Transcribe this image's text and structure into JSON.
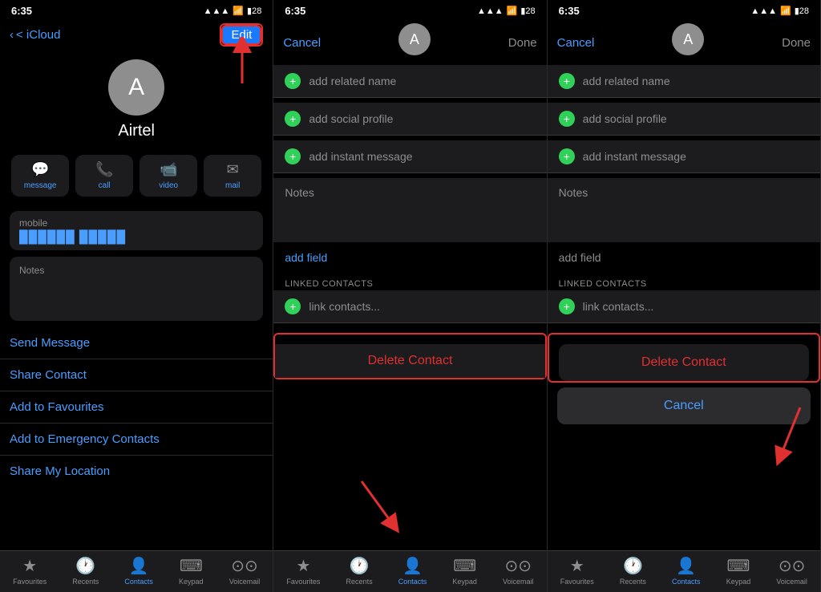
{
  "panel1": {
    "status": {
      "time": "6:35",
      "signal": "▲▲▲",
      "wifi": "WiFi",
      "battery": "28"
    },
    "nav": {
      "back": "< iCloud",
      "edit": "Edit"
    },
    "avatar": "A",
    "contact_name": "Airtel",
    "actions": [
      {
        "id": "message",
        "icon": "💬",
        "label": "message"
      },
      {
        "id": "call",
        "icon": "📞",
        "label": "call"
      },
      {
        "id": "video",
        "icon": "📹",
        "label": "video"
      },
      {
        "id": "mail",
        "icon": "✉",
        "label": "mail"
      }
    ],
    "mobile_label": "mobile",
    "mobile_value": "██████ █████",
    "notes_label": "Notes",
    "links": [
      "Send Message",
      "Share Contact",
      "Add to Favourites",
      "Add to Emergency Contacts",
      "Share My Location"
    ],
    "tabs": [
      {
        "id": "favourites",
        "icon": "★",
        "label": "Favourites",
        "active": false
      },
      {
        "id": "recents",
        "icon": "🕐",
        "label": "Recents",
        "active": false
      },
      {
        "id": "contacts",
        "icon": "👤",
        "label": "Contacts",
        "active": true
      },
      {
        "id": "keypad",
        "icon": "⌨",
        "label": "Keypad",
        "active": false
      },
      {
        "id": "voicemail",
        "icon": "⃝⃝",
        "label": "Voicemail",
        "active": false
      }
    ]
  },
  "panel2": {
    "status": {
      "time": "6:35"
    },
    "nav": {
      "cancel": "Cancel",
      "done": "Done"
    },
    "avatar": "A",
    "add_rows": [
      {
        "id": "related",
        "label": "add related name"
      },
      {
        "id": "social",
        "label": "add social profile"
      },
      {
        "id": "instant",
        "label": "add instant message"
      }
    ],
    "notes_label": "Notes",
    "add_field": "add field",
    "linked_header": "LINKED CONTACTS",
    "link_contacts": "link contacts...",
    "delete_contact": "Delete Contact"
  },
  "panel3": {
    "status": {
      "time": "6:35"
    },
    "nav": {
      "cancel": "Cancel",
      "done": "Done"
    },
    "avatar": "A",
    "add_rows": [
      {
        "id": "related",
        "label": "add related name"
      },
      {
        "id": "social",
        "label": "add social profile"
      },
      {
        "id": "instant",
        "label": "add instant message"
      }
    ],
    "notes_label": "Notes",
    "add_field": "add field",
    "linked_header": "LINKED CONTACTS",
    "link_contacts": "link contacts...",
    "delete_contact": "Delete Contact",
    "cancel_btn": "Cancel"
  },
  "colors": {
    "accent_blue": "#4a9eff",
    "accent_green": "#30d158",
    "accent_red": "#e03030",
    "bg_dark": "#000000",
    "bg_card": "#1c1c1e",
    "text_gray": "#8e8e8e",
    "text_white": "#ffffff"
  }
}
